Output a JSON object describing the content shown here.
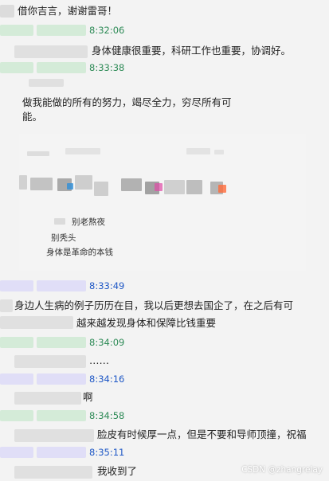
{
  "colors": {
    "green_time": "#2e8b57",
    "blue_time": "#1f58c6",
    "text": "#222222",
    "blur_green": "#c9e8cf",
    "blur_purple": "#dcd9f7",
    "blur_gray": "#cfcfcf"
  },
  "messages": [
    {
      "text": "借你吉言，谢谢雷哥！"
    },
    {
      "time": "8:32:06",
      "text": "身体健康很重要，科研工作也重要，协调好。"
    },
    {
      "time": "8:33:38",
      "text1": "做我能做的所有的努力，竭尽全力，穷尽所有可",
      "text2": "能。"
    },
    {
      "time": "8:33:49",
      "text1": "身边人生病的例子历历在目，我以后更想去国企了，在之后有可",
      "text2": "越来越发现身体和保障比钱重要"
    },
    {
      "time": "8:34:09",
      "text": "……"
    },
    {
      "time": "8:34:16",
      "text": "啊"
    },
    {
      "time": "8:34:58",
      "text": "脸皮有时候厚一点，但是不要和导师顶撞，祝福"
    },
    {
      "time": "8:35:11",
      "text": "我收到了"
    }
  ],
  "image_card": {
    "line1": "别老熬夜",
    "line2": "别秃头",
    "line3": "身体是革命的本钱"
  },
  "watermark": "CSDN @zhangrelay"
}
